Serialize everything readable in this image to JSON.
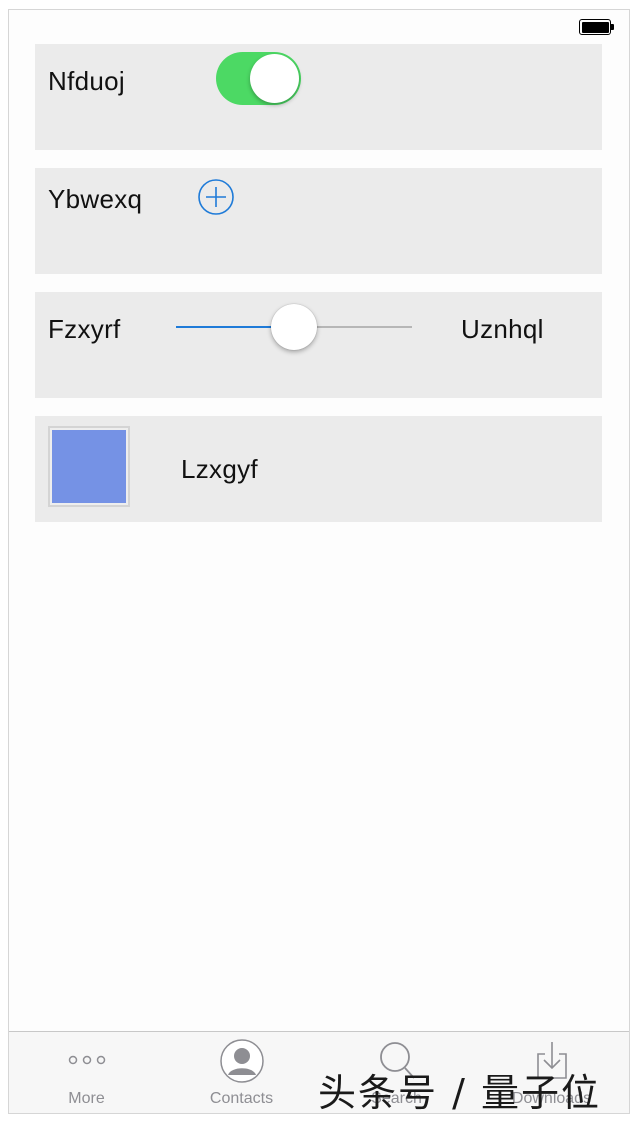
{
  "rows": {
    "switch_row": {
      "label": "Nfduoj",
      "switch_on": true
    },
    "add_row": {
      "label": "Ybwexq"
    },
    "slider_row": {
      "label": "Fzxyrf",
      "value_label": "Uznhql",
      "slider_value": 0.5
    },
    "color_row": {
      "label": "Lzxgyf",
      "swatch_color": "#7592e5"
    }
  },
  "colors": {
    "switch_on": "#4cd964",
    "accent_blue": "#1f7bd8",
    "row_bg": "#ebebeb"
  },
  "tabbar": {
    "tabs": [
      {
        "label": "More",
        "icon": "more-icon"
      },
      {
        "label": "Contacts",
        "icon": "contacts-icon"
      },
      {
        "label": "Search",
        "icon": "search-icon"
      },
      {
        "label": "Downloads",
        "icon": "downloads-icon"
      }
    ]
  },
  "watermark": {
    "text": "头条号 / 量子位"
  }
}
